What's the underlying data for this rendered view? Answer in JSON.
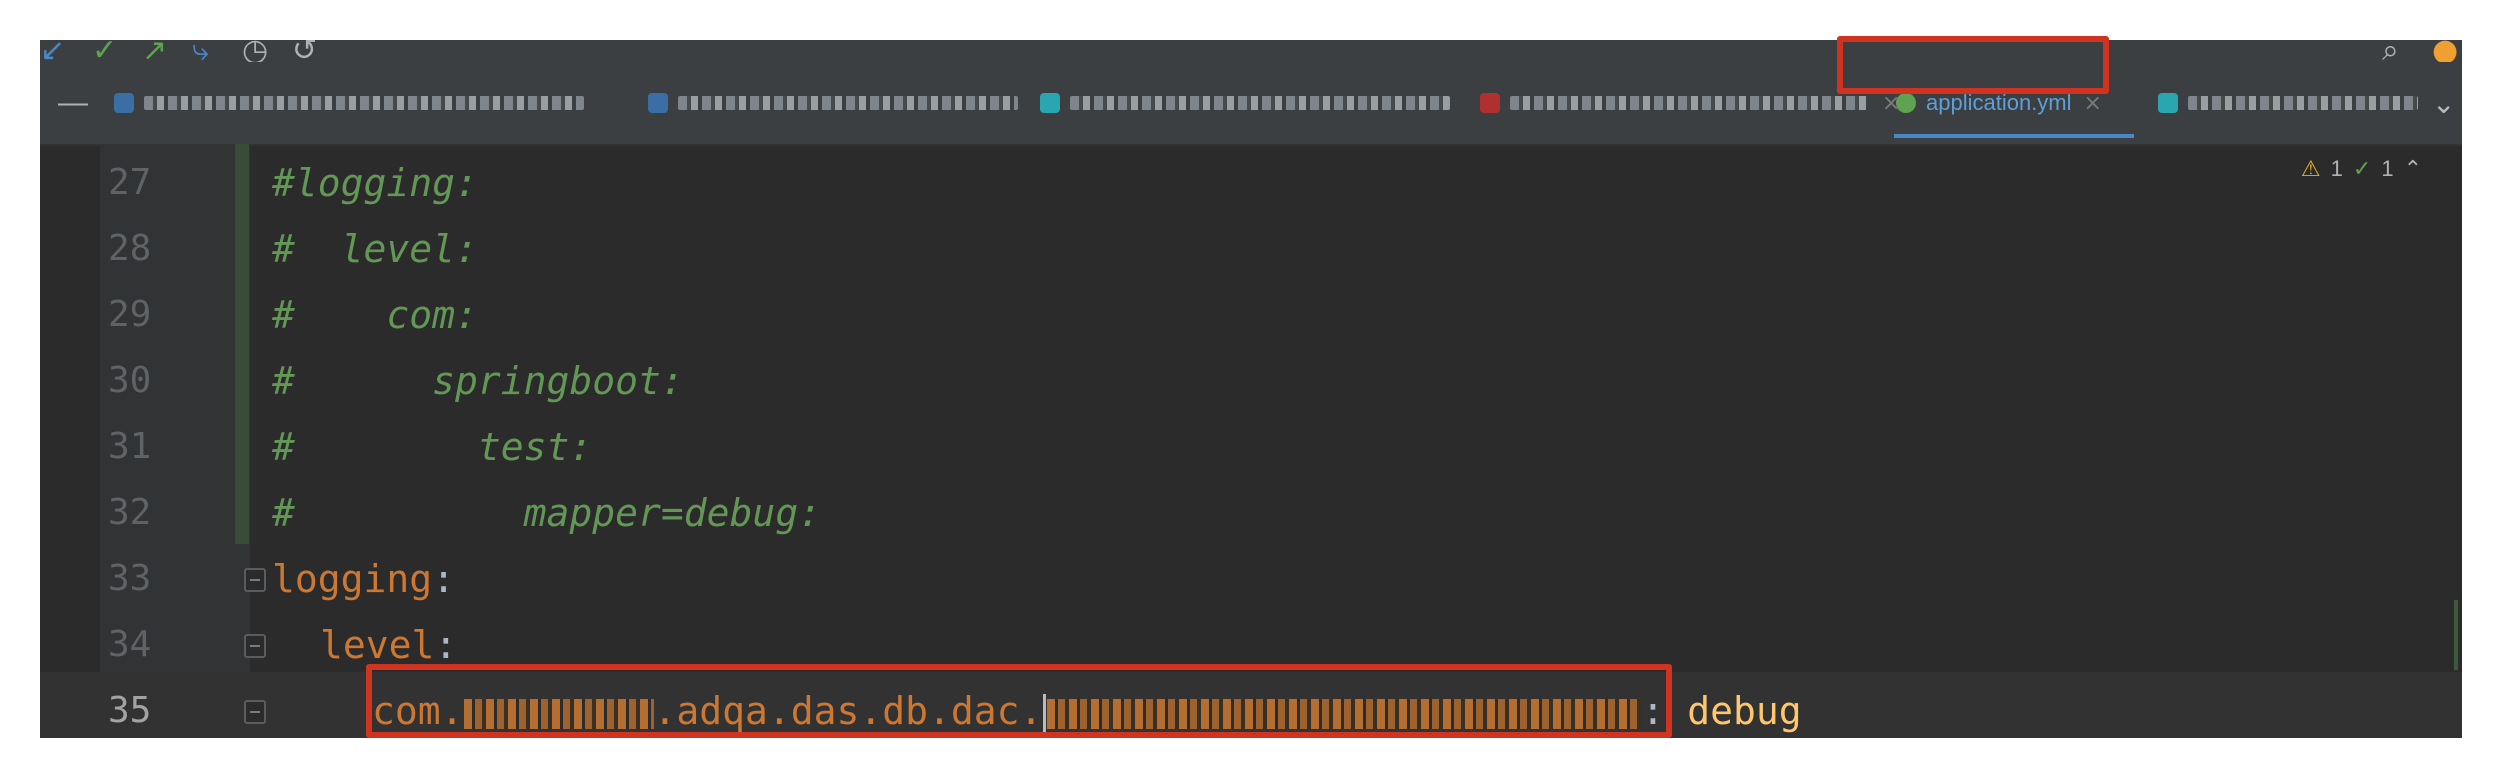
{
  "toolbar": {
    "icons": [
      "arrow-in-icon",
      "check-icon",
      "arrow-up-right-icon",
      "merge-icon",
      "history-icon",
      "undo-icon",
      "search-icon",
      "notification-icon"
    ],
    "glyphs": [
      "↙",
      "✓",
      "↗",
      "⤷",
      "◷",
      "↺",
      "⌕",
      "●"
    ]
  },
  "tabs": {
    "active": {
      "label": "application.yml",
      "close": "×"
    },
    "more": "⌄",
    "collapse": "—"
  },
  "inspections": {
    "warnings": "1",
    "weak_warnings": "1",
    "warn_glyph": "⚠",
    "ok_glyph": "✓",
    "up_glyph": "⌃"
  },
  "lines": [
    {
      "num": "27",
      "text": "#logging:"
    },
    {
      "num": "28",
      "text": "#  level:"
    },
    {
      "num": "29",
      "text": "#    com:"
    },
    {
      "num": "30",
      "text": "#      springboot:"
    },
    {
      "num": "31",
      "text": "#        test:"
    },
    {
      "num": "32",
      "text": "#          mapper=debug:"
    },
    {
      "num": "33",
      "key": "logging",
      "colon": ":"
    },
    {
      "num": "34",
      "key": "level",
      "colon": ":"
    },
    {
      "num": "35",
      "prefix": "com.",
      "mid": ".adqa.das.db.dac.",
      "colon": ":",
      "value": "debug"
    }
  ],
  "colors": {
    "accent": "#4a88c7",
    "highlight": "#d0331f",
    "comment": "#629755",
    "keyword": "#cc7832",
    "value": "#ffc66d"
  }
}
